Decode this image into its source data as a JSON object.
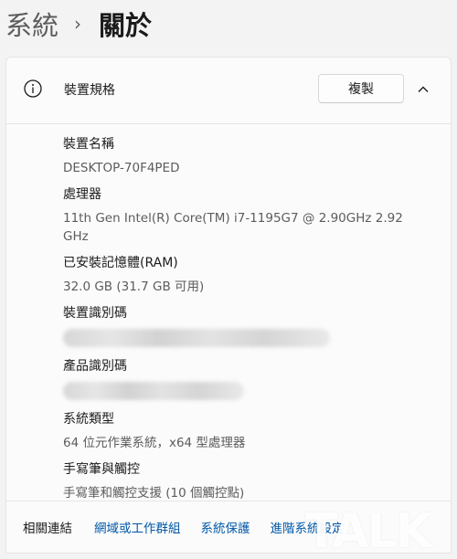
{
  "breadcrumb": {
    "parent": "系統",
    "separator": "›",
    "current": "關於"
  },
  "device_specs": {
    "header_title": "裝置規格",
    "copy_label": "複製",
    "icons": {
      "info": "info-icon",
      "collapse": "chevron-up-icon"
    },
    "device_name_label": "裝置名稱",
    "device_name_value": "DESKTOP-70F4PED",
    "processor_label": "處理器",
    "processor_value": "11th Gen Intel(R) Core(TM) i7-1195G7 @ 2.90GHz   2.92 GHz",
    "ram_label": "已安裝記憶體(RAM)",
    "ram_value": "32.0 GB (31.7 GB 可用)",
    "device_id_label": "裝置識別碼",
    "product_id_label": "產品識別碼",
    "system_type_label": "系統類型",
    "system_type_value": "64 位元作業系統，x64 型處理器",
    "pen_touch_label": "手寫筆與觸控",
    "pen_touch_value": "手寫筆和觸控支援 (10 個觸控點)"
  },
  "related_links": {
    "title": "相關連結",
    "links": [
      "網域或工作群組",
      "系統保護",
      "進階系統設定"
    ]
  },
  "watermark": "TALK",
  "colors": {
    "background": "#f3f3f3",
    "card": "#fbfbfb",
    "link": "#0058a8"
  }
}
